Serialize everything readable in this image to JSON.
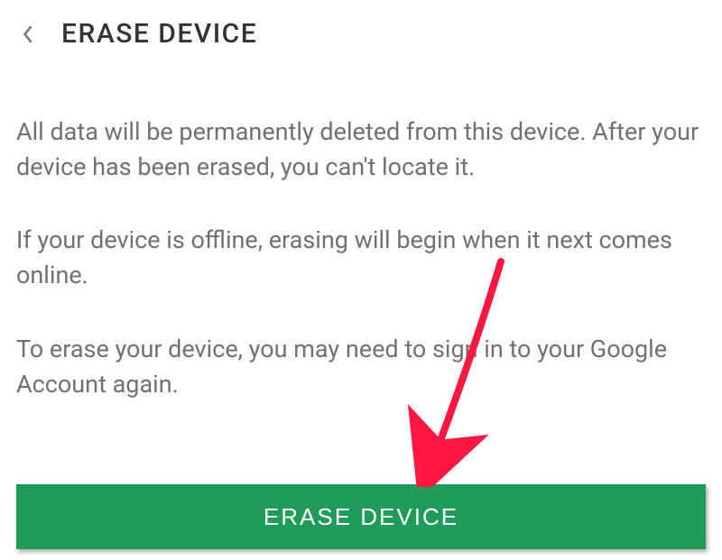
{
  "header": {
    "title": "ERASE DEVICE"
  },
  "body": {
    "p1": "All data will be permanently deleted from this device. After your device has been erased, you can't locate it.",
    "p2": "If your device is offline, erasing will begin when it next comes online.",
    "p3": "To erase your device, you may need to sign in to your Google Account again."
  },
  "button": {
    "label": "ERASE DEVICE"
  },
  "colors": {
    "button_bg": "#1f9c5a",
    "text": "#6f7172",
    "arrow": "#ff1744"
  }
}
